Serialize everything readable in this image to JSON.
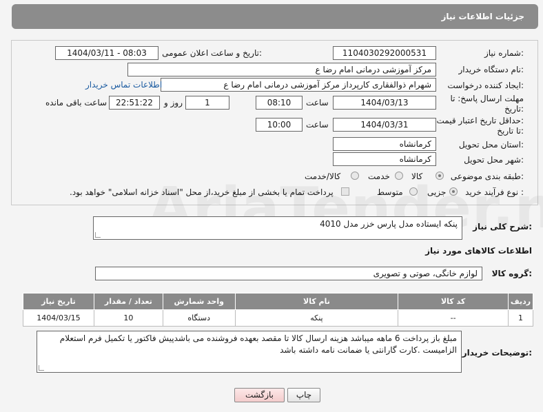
{
  "header": {
    "title": "جزئیات اطلاعات نیاز"
  },
  "need_number": {
    "label": "شماره نیاز:",
    "value": "1104030292000531"
  },
  "announce_datetime": {
    "label": "تاریخ و ساعت اعلان عمومی:",
    "value": "1404/03/11 - 08:03"
  },
  "buyer_org": {
    "label": "نام دستگاه خریدار:",
    "value": "مرکز آموزشی  درمانی امام رضا  ع"
  },
  "requester": {
    "label": "ایجاد کننده درخواست:",
    "value": "شهرام ذوالفقاری کارپرداز مرکز آموزشی  درمانی امام رضا  ع",
    "contact_link": "اطلاعات تماس خریدار"
  },
  "reply_deadline": {
    "label_line1": "مهلت ارسال پاسخ: تا",
    "label_line2": "تاریخ:",
    "date": "1404/03/13",
    "time_label": "ساعت",
    "time": "08:10",
    "days": "1",
    "days_label": "روز و",
    "remaining": "22:51:22",
    "remaining_label": "ساعت باقی مانده"
  },
  "price_validity": {
    "label_line1": "حداقل تاریخ اعتبار قیمت:",
    "label_line2": "تا تاریخ:",
    "date": "1404/03/31",
    "time_label": "ساعت",
    "time": "10:00"
  },
  "delivery_province": {
    "label": "استان محل تحویل:",
    "value": "کرمانشاه"
  },
  "delivery_city": {
    "label": "شهر محل تحویل:",
    "value": "کرمانشاه"
  },
  "category": {
    "label": "طبقه بندی موضوعی:",
    "options": [
      "کالا",
      "خدمت",
      "کالا/خدمت"
    ],
    "selected": "کالا"
  },
  "purchase_type": {
    "label": "نوع فرآیند خرید :",
    "options": [
      "جزیی",
      "متوسط"
    ],
    "selected": "جزیی",
    "payment_note": "پرداخت تمام یا بخشی از مبلغ خرید،از محل \"اسناد خزانه اسلامی\" خواهد بود."
  },
  "description": {
    "label": "شرح کلی نیاز:",
    "value": "پنکه ایستاده مدل پارس خزر مدل 4010"
  },
  "goods_info": {
    "title": "اطلاعات کالاهای مورد نیاز"
  },
  "goods_group": {
    "label": "گروه کالا:",
    "value": "لوازم خانگی، صوتی و تصویری"
  },
  "table": {
    "headers": [
      "ردیف",
      "کد کالا",
      "نام کالا",
      "واحد شمارش",
      "تعداد / مقدار",
      "تاریخ نیاز"
    ],
    "rows": [
      [
        "1",
        "--",
        "پنکه",
        "دستگاه",
        "10",
        "1404/03/15"
      ]
    ]
  },
  "buyer_notes": {
    "label": "توضیحات خریدار:",
    "value": "مبلغ باز پرداخت 6 ماهه میباشد هزینه ارسال کالا تا مقصد بعهده فروشنده می باشدپیش فاکتور یا تکمیل فرم استعلام الزامیست .کارت گارانتی یا ضمانت نامه داشته باشد"
  },
  "buttons": {
    "print": "چاپ",
    "back": "بازگشت"
  },
  "watermark": {
    "text": "AriaTender.net"
  }
}
